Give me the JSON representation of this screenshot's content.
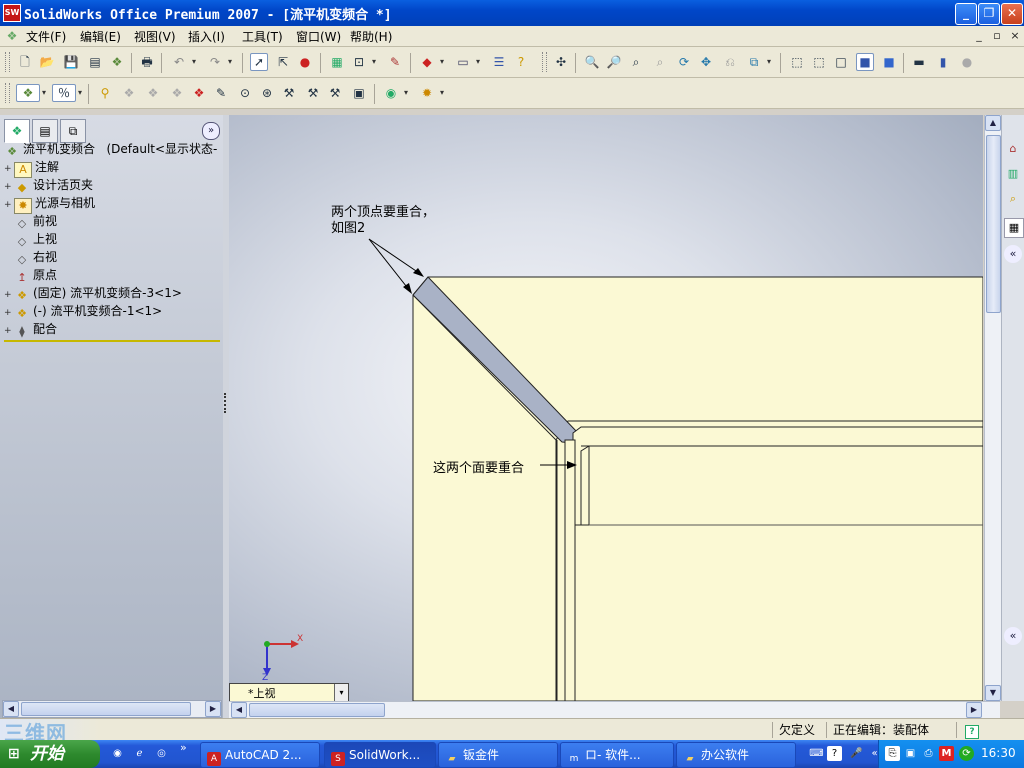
{
  "window": {
    "title": "SolidWorks Office Premium 2007 - [流平机变频合 *]",
    "icon": "solidworks-logo-icon",
    "controls": [
      "minimize",
      "restore",
      "close"
    ]
  },
  "menubar": {
    "items": [
      "文件(F)",
      "编辑(E)",
      "视图(V)",
      "插入(I)",
      "工具(T)",
      "窗口(W)",
      "帮助(H)"
    ],
    "mdi_controls": [
      "_",
      "▫",
      "×"
    ]
  },
  "feature_manager": {
    "root_label": "流平机变频合",
    "root_config": "(Default<显示状态-",
    "items": [
      {
        "label": "注解",
        "icon": "annotations-icon",
        "expandable": true
      },
      {
        "label": "设计活页夹",
        "icon": "design-binder-icon",
        "expandable": true
      },
      {
        "label": "光源与相机",
        "icon": "lights-cameras-icon",
        "expandable": true
      },
      {
        "label": "前视",
        "icon": "plane-icon",
        "expandable": false
      },
      {
        "label": "上视",
        "icon": "plane-icon",
        "expandable": false
      },
      {
        "label": "右视",
        "icon": "plane-icon",
        "expandable": false
      },
      {
        "label": "原点",
        "icon": "origin-icon",
        "expandable": false
      },
      {
        "label": "(固定) 流平机变频合-3<1>",
        "icon": "part-icon",
        "expandable": true
      },
      {
        "label": "(-) 流平机变频合-1<1>",
        "icon": "part-icon",
        "expandable": true
      },
      {
        "label": "配合",
        "icon": "mates-icon",
        "expandable": true
      }
    ]
  },
  "viewport": {
    "annotation_vertices": "两个顶点要重合，\n如图2",
    "annotation_faces": "这两个面要重合",
    "view_selector": "*上视",
    "triad": {
      "x": "X",
      "z": "Z"
    },
    "part_fill": "#fbf9d4"
  },
  "statusbar": {
    "state": "欠定义",
    "editing": "正在编辑：装配体",
    "help": "?"
  },
  "taskbar": {
    "start_label": "开始",
    "watermark": "三维网",
    "tasks": [
      {
        "label": "AutoCAD 2...",
        "icon": "autocad-icon",
        "active": false
      },
      {
        "label": "SolidWork...",
        "icon": "solidworks-logo-icon",
        "active": true
      },
      {
        "label": "钣金件",
        "icon": "folder-icon",
        "active": false
      },
      {
        "label": "ロ- 软件...",
        "icon": "browser-icon",
        "active": false
      },
      {
        "label": "办公软件",
        "icon": "folder-icon",
        "active": false
      }
    ],
    "clock": "16:30"
  }
}
